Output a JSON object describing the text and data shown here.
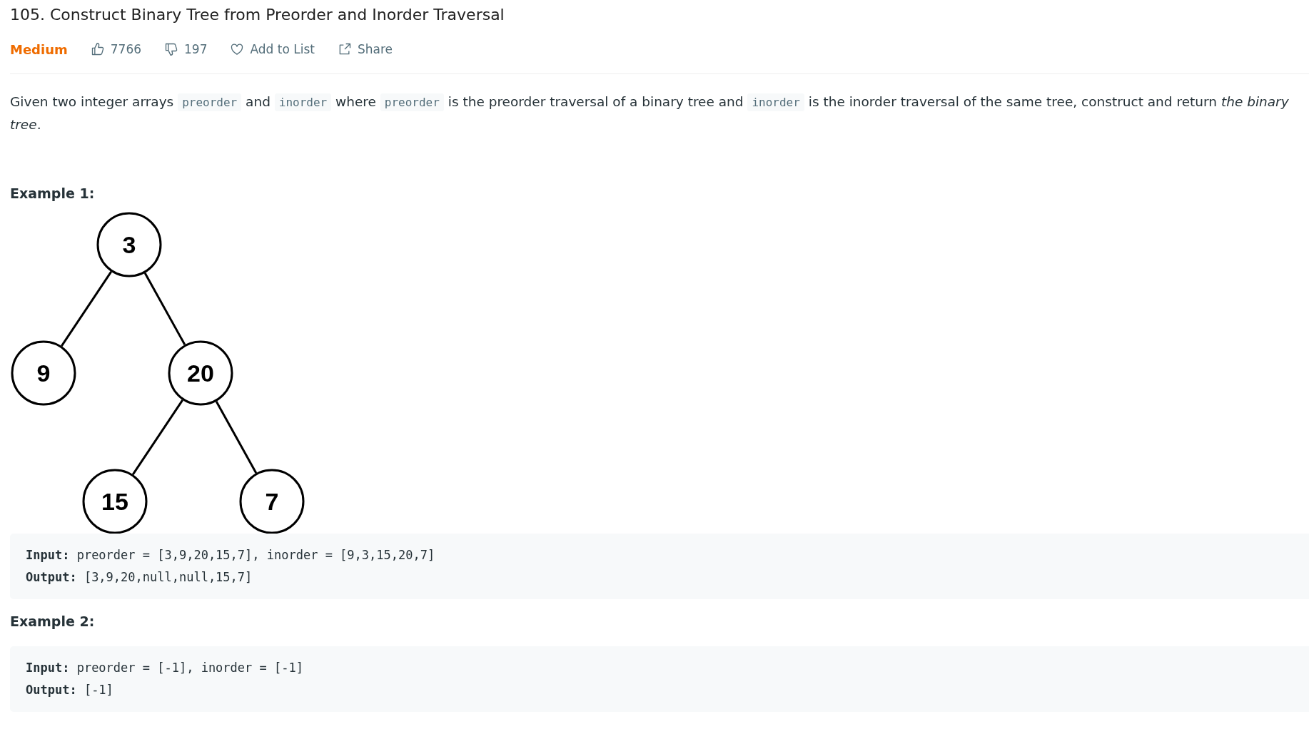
{
  "problem": {
    "title": "105. Construct Binary Tree from Preorder and Inorder Traversal",
    "difficulty": "Medium",
    "likes": "7766",
    "dislikes": "197",
    "add_to_list": "Add to List",
    "share": "Share"
  },
  "description": [
    {
      "kind": "text",
      "text": "Given two integer arrays "
    },
    {
      "kind": "code",
      "text": "preorder"
    },
    {
      "kind": "text",
      "text": " and "
    },
    {
      "kind": "code",
      "text": "inorder"
    },
    {
      "kind": "text",
      "text": " where "
    },
    {
      "kind": "code",
      "text": "preorder"
    },
    {
      "kind": "text",
      "text": " is the preorder traversal of a binary tree and "
    },
    {
      "kind": "code",
      "text": "inorder"
    },
    {
      "kind": "text",
      "text": " is the inorder traversal of the same tree, construct and return "
    },
    {
      "kind": "italic",
      "text": "the binary tree"
    },
    {
      "kind": "text",
      "text": "."
    }
  ],
  "examples": [
    {
      "heading": "Example 1:",
      "tree": {
        "value": "3",
        "children": [
          {
            "value": "9"
          },
          {
            "value": "20",
            "children": [
              {
                "value": "15"
              },
              {
                "value": "7"
              }
            ]
          }
        ]
      },
      "lines": [
        {
          "label": "Input:",
          "value": " preorder = [3,9,20,15,7], inorder = [9,3,15,20,7]"
        },
        {
          "label": "Output:",
          "value": " [3,9,20,null,null,15,7]"
        }
      ]
    },
    {
      "heading": "Example 2:",
      "lines": [
        {
          "label": "Input:",
          "value": " preorder = [-1], inorder = [-1]"
        },
        {
          "label": "Output:",
          "value": " [-1]"
        }
      ]
    }
  ]
}
